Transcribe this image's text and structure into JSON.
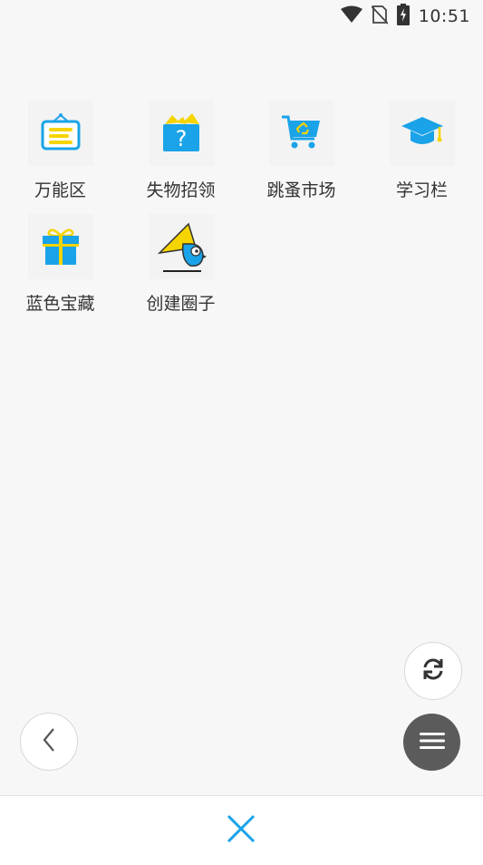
{
  "status_bar": {
    "time": "10:51",
    "icons": [
      "wifi-icon",
      "no-sim-icon",
      "battery-charging-icon"
    ]
  },
  "grid": {
    "items": [
      {
        "label": "万能区",
        "icon": "notice-board-icon"
      },
      {
        "label": "失物招领",
        "icon": "lost-box-icon"
      },
      {
        "label": "跳蚤市场",
        "icon": "recycle-cart-icon"
      },
      {
        "label": "学习栏",
        "icon": "graduation-cap-icon"
      },
      {
        "label": "蓝色宝藏",
        "icon": "gift-icon"
      },
      {
        "label": "创建圈子",
        "icon": "bird-horn-icon"
      }
    ]
  },
  "colors": {
    "accent_blue": "#1aa3e8",
    "accent_yellow": "#f5d400",
    "background": "#f7f7f7",
    "menu_fab": "#5b5b5b"
  },
  "controls": {
    "refresh": "refresh-icon",
    "back": "chevron-left-icon",
    "menu": "hamburger-icon",
    "close": "close-icon"
  }
}
